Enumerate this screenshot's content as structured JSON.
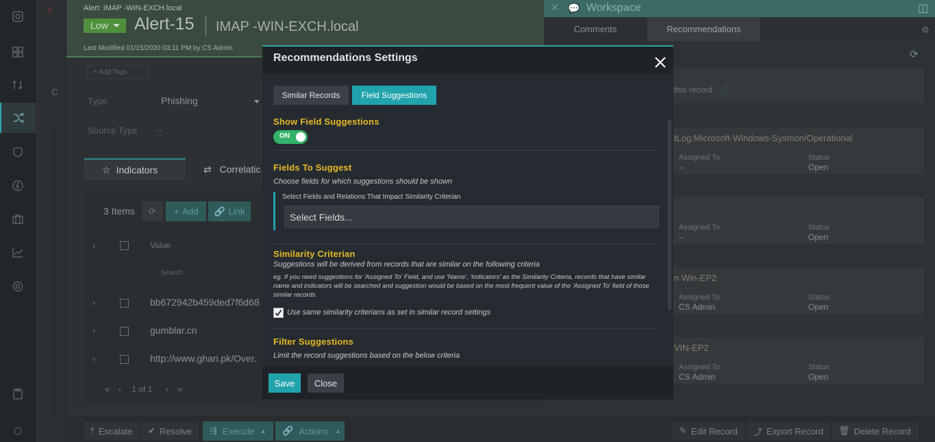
{
  "background": {
    "breadcrumb": "Alert: IMAP -WIN-EXCH.local",
    "severity": "Low",
    "record_title": "Alert-15",
    "record_subtitle": "IMAP -WIN-EXCH.local",
    "last_modified": "Last Modified 01/15/2020 03:11 PM by CS Admin",
    "add_tags": "+ Add Tags",
    "left_letter": "C",
    "fields": [
      {
        "label": "Type",
        "value": "Phishing"
      },
      {
        "label": "Source Type",
        "value": "--"
      }
    ],
    "tabs": [
      {
        "label": "Indicators"
      },
      {
        "label": "Correlatic"
      }
    ],
    "grid": {
      "count": "3 Items",
      "add_label": "Add",
      "link_label": "Link",
      "column_value": "Value",
      "search_placeholder": "Search",
      "rows": [
        {
          "value": "bb672942b459ded7f6d68"
        },
        {
          "value": "gumblar.cn"
        },
        {
          "value": "http://www.ghari.pk/Over."
        }
      ],
      "pager": "1 of 1"
    },
    "bottom_actions": [
      {
        "label": "Escalate"
      },
      {
        "label": "Resolve"
      },
      {
        "label": "Execute"
      },
      {
        "label": "Actions"
      },
      {
        "label": "Edit Record"
      },
      {
        "label": "Export Record"
      },
      {
        "label": "Delete Record"
      }
    ]
  },
  "workspace": {
    "title": "Workspace",
    "tabs": [
      {
        "label": "Comments"
      },
      {
        "label": "Recommendations"
      }
    ],
    "hint": "this record",
    "cards": [
      {
        "title": "tLog:Microsoft-Windows-Sysmon/Operational",
        "assigned_label": "Assigned To",
        "assigned": "--",
        "status_label": "Status",
        "status": "Open"
      },
      {
        "title": "",
        "assigned_label": "Assigned To",
        "assigned": "--",
        "status_label": "Status",
        "status": "Open"
      },
      {
        "title": "n Win-EP2",
        "assigned_label": "Assigned To",
        "assigned": "CS Admin",
        "status_label": "Status",
        "status": "Open"
      },
      {
        "title": "VIN-EP2",
        "assigned_label": "Assigned To",
        "assigned": "CS Admin",
        "status_label": "Status",
        "status": "Open"
      }
    ]
  },
  "modal": {
    "title": "Recommendations Settings",
    "tabs": [
      {
        "label": "Similar Records",
        "active": false
      },
      {
        "label": "Field Suggestions",
        "active": true
      }
    ],
    "show_field_suggestions": {
      "title": "Show Field Suggestions",
      "toggle_label": "ON",
      "enabled": true
    },
    "fields_to_suggest": {
      "title": "Fields To Suggest",
      "description": "Choose fields for which suggestions should be shown",
      "panel_label": "Select Fields and Relations That Impact Similarity Criterian",
      "select_placeholder": "Select Fields..."
    },
    "similarity": {
      "title": "Similarity Criterian",
      "description": "Suggestions will be derived from records that are similar on the following criteria",
      "example": "eg. If you need suggestions for 'Assigned To' Field, and use 'Name', 'Indicators' as the Similarity Criteria, records that have similar name and indicators will be searched and suggestion would be based on the most frequent value of the 'Assigned To' field of those similar records",
      "checkbox_label": "Use same similarity criterians as set in similar record settings",
      "checked": true
    },
    "filter": {
      "title": "Filter Suggestions",
      "description": "Limit the record suggestions based on the below criteria"
    },
    "save_label": "Save",
    "close_label": "Close"
  },
  "colors": {
    "accent": "#21a3ad",
    "section_title": "#e6b927",
    "toggle_on": "#34b36a"
  }
}
